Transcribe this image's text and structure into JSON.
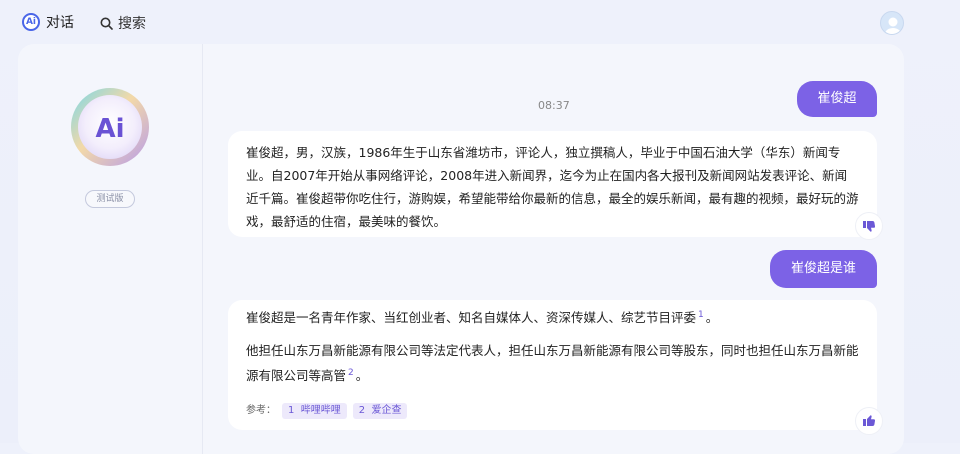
{
  "topbar": {
    "brand_logo": "Ai",
    "brand_label": "对话",
    "search_label": "搜索"
  },
  "bot": {
    "avatar_text": "Ai",
    "badge": "测试版"
  },
  "chat": {
    "time": "08:37",
    "messages": [
      {
        "role": "user",
        "text": "崔俊超"
      },
      {
        "role": "bot",
        "text": "崔俊超，男，汉族，1986年生于山东省潍坊市，评论人，独立撰稿人，毕业于中国石油大学（华东）新闻专业。自2007年开始从事网络评论，2008年进入新闻界，迄今为止在国内各大报刊及新闻网站发表评论、新闻近千篇。崔俊超带你吃住行，游购娱，希望能带给你最新的信息，最全的娱乐新闻，最有趣的视频，最好玩的游戏，最舒适的住宿，最美味的餐饮。"
      },
      {
        "role": "user",
        "text": "崔俊超是谁"
      },
      {
        "role": "bot",
        "p1": "崔俊超是一名青年作家、当红创业者、知名自媒体人、资深传媒人、综艺节目评委",
        "p1_ref": "1",
        "p1_end": "。",
        "p2": "他担任山东万昌新能源有限公司等法定代表人，担任山东万昌新能源有限公司等股东，同时也担任山东万昌新能源有限公司等高管",
        "p2_ref": "2",
        "p2_end": "。",
        "refs_label": "参考：",
        "refs": [
          {
            "num": "1",
            "name": "哔哩哔哩"
          },
          {
            "num": "2",
            "name": "爱企查"
          }
        ]
      }
    ]
  },
  "colors": {
    "accent": "#7c62e6",
    "brand_blue": "#4a66e8",
    "background": "#eef1fb",
    "panel": "#f4f6fc"
  },
  "icons": {
    "search": "search-icon",
    "dislike": "thumbs-down-icon",
    "like": "thumbs-up-icon"
  }
}
